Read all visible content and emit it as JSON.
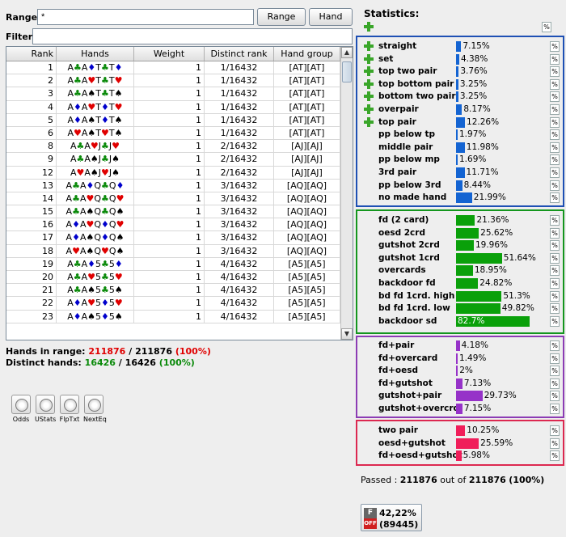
{
  "range": {
    "label": "Range:",
    "value": "*",
    "range_button": "Range",
    "hand_button": "Hand"
  },
  "filter": {
    "label": "Filter:",
    "value": ""
  },
  "table": {
    "columns": [
      "Rank",
      "Hands",
      "Weight",
      "Distinct rank",
      "Hand group"
    ],
    "rows": [
      {
        "rank": "1",
        "hand": [
          [
            "A",
            "c"
          ],
          [
            "A",
            "d"
          ],
          [
            "T",
            "c"
          ],
          [
            "T",
            "d"
          ]
        ],
        "weight": "1",
        "distinct": "1/16432",
        "group": "[AT][AT]"
      },
      {
        "rank": "2",
        "hand": [
          [
            "A",
            "c"
          ],
          [
            "A",
            "h"
          ],
          [
            "T",
            "c"
          ],
          [
            "T",
            "h"
          ]
        ],
        "weight": "1",
        "distinct": "1/16432",
        "group": "[AT][AT]"
      },
      {
        "rank": "3",
        "hand": [
          [
            "A",
            "c"
          ],
          [
            "A",
            "s"
          ],
          [
            "T",
            "c"
          ],
          [
            "T",
            "s"
          ]
        ],
        "weight": "1",
        "distinct": "1/16432",
        "group": "[AT][AT]"
      },
      {
        "rank": "4",
        "hand": [
          [
            "A",
            "d"
          ],
          [
            "A",
            "h"
          ],
          [
            "T",
            "d"
          ],
          [
            "T",
            "h"
          ]
        ],
        "weight": "1",
        "distinct": "1/16432",
        "group": "[AT][AT]"
      },
      {
        "rank": "5",
        "hand": [
          [
            "A",
            "d"
          ],
          [
            "A",
            "s"
          ],
          [
            "T",
            "d"
          ],
          [
            "T",
            "s"
          ]
        ],
        "weight": "1",
        "distinct": "1/16432",
        "group": "[AT][AT]"
      },
      {
        "rank": "6",
        "hand": [
          [
            "A",
            "h"
          ],
          [
            "A",
            "s"
          ],
          [
            "T",
            "h"
          ],
          [
            "T",
            "s"
          ]
        ],
        "weight": "1",
        "distinct": "1/16432",
        "group": "[AT][AT]"
      },
      {
        "rank": "8",
        "hand": [
          [
            "A",
            "c"
          ],
          [
            "A",
            "h"
          ],
          [
            "J",
            "c"
          ],
          [
            "J",
            "h"
          ]
        ],
        "weight": "1",
        "distinct": "2/16432",
        "group": "[AJ][AJ]"
      },
      {
        "rank": "9",
        "hand": [
          [
            "A",
            "c"
          ],
          [
            "A",
            "s"
          ],
          [
            "J",
            "c"
          ],
          [
            "J",
            "s"
          ]
        ],
        "weight": "1",
        "distinct": "2/16432",
        "group": "[AJ][AJ]"
      },
      {
        "rank": "12",
        "hand": [
          [
            "A",
            "h"
          ],
          [
            "A",
            "s"
          ],
          [
            "J",
            "h"
          ],
          [
            "J",
            "s"
          ]
        ],
        "weight": "1",
        "distinct": "2/16432",
        "group": "[AJ][AJ]"
      },
      {
        "rank": "13",
        "hand": [
          [
            "A",
            "c"
          ],
          [
            "A",
            "d"
          ],
          [
            "Q",
            "c"
          ],
          [
            "Q",
            "d"
          ]
        ],
        "weight": "1",
        "distinct": "3/16432",
        "group": "[AQ][AQ]"
      },
      {
        "rank": "14",
        "hand": [
          [
            "A",
            "c"
          ],
          [
            "A",
            "h"
          ],
          [
            "Q",
            "c"
          ],
          [
            "Q",
            "h"
          ]
        ],
        "weight": "1",
        "distinct": "3/16432",
        "group": "[AQ][AQ]"
      },
      {
        "rank": "15",
        "hand": [
          [
            "A",
            "c"
          ],
          [
            "A",
            "s"
          ],
          [
            "Q",
            "c"
          ],
          [
            "Q",
            "s"
          ]
        ],
        "weight": "1",
        "distinct": "3/16432",
        "group": "[AQ][AQ]"
      },
      {
        "rank": "16",
        "hand": [
          [
            "A",
            "d"
          ],
          [
            "A",
            "h"
          ],
          [
            "Q",
            "d"
          ],
          [
            "Q",
            "h"
          ]
        ],
        "weight": "1",
        "distinct": "3/16432",
        "group": "[AQ][AQ]"
      },
      {
        "rank": "17",
        "hand": [
          [
            "A",
            "d"
          ],
          [
            "A",
            "s"
          ],
          [
            "Q",
            "d"
          ],
          [
            "Q",
            "s"
          ]
        ],
        "weight": "1",
        "distinct": "3/16432",
        "group": "[AQ][AQ]"
      },
      {
        "rank": "18",
        "hand": [
          [
            "A",
            "h"
          ],
          [
            "A",
            "s"
          ],
          [
            "Q",
            "h"
          ],
          [
            "Q",
            "s"
          ]
        ],
        "weight": "1",
        "distinct": "3/16432",
        "group": "[AQ][AQ]"
      },
      {
        "rank": "19",
        "hand": [
          [
            "A",
            "c"
          ],
          [
            "A",
            "d"
          ],
          [
            "5",
            "c"
          ],
          [
            "5",
            "d"
          ]
        ],
        "weight": "1",
        "distinct": "4/16432",
        "group": "[A5][A5]"
      },
      {
        "rank": "20",
        "hand": [
          [
            "A",
            "c"
          ],
          [
            "A",
            "h"
          ],
          [
            "5",
            "c"
          ],
          [
            "5",
            "h"
          ]
        ],
        "weight": "1",
        "distinct": "4/16432",
        "group": "[A5][A5]"
      },
      {
        "rank": "21",
        "hand": [
          [
            "A",
            "c"
          ],
          [
            "A",
            "s"
          ],
          [
            "5",
            "c"
          ],
          [
            "5",
            "s"
          ]
        ],
        "weight": "1",
        "distinct": "4/16432",
        "group": "[A5][A5]"
      },
      {
        "rank": "22",
        "hand": [
          [
            "A",
            "d"
          ],
          [
            "A",
            "h"
          ],
          [
            "5",
            "d"
          ],
          [
            "5",
            "h"
          ]
        ],
        "weight": "1",
        "distinct": "4/16432",
        "group": "[A5][A5]"
      },
      {
        "rank": "23",
        "hand": [
          [
            "A",
            "d"
          ],
          [
            "A",
            "s"
          ],
          [
            "5",
            "d"
          ],
          [
            "5",
            "s"
          ]
        ],
        "weight": "1",
        "distinct": "4/16432",
        "group": "[A5][A5]"
      }
    ]
  },
  "suit_colors": {
    "c": "#0a8a0a",
    "d": "#0000cc",
    "h": "#e00000",
    "s": "#000000"
  },
  "summary": {
    "hands_label": "Hands in range:",
    "hands_value": "211876",
    "hands_sep": "/",
    "hands_total": "211876",
    "hands_pct": "(100%)",
    "distinct_label": "Distinct hands:",
    "distinct_value": "16426",
    "distinct_sep": "/",
    "distinct_total": "16426",
    "distinct_pct": "(100%)"
  },
  "tools": [
    "Odds",
    "UStats",
    "FlpTxt",
    "NextEq"
  ],
  "stats": {
    "title": "Statistics:",
    "pct_symbol": "%",
    "made": [
      {
        "name": "straight",
        "value": 7.15,
        "label": "7.15%",
        "expandable": true
      },
      {
        "name": "set",
        "value": 4.38,
        "label": "4.38%",
        "expandable": true
      },
      {
        "name": "top two pair",
        "value": 3.76,
        "label": "3.76%",
        "expandable": true
      },
      {
        "name": "top bottom pair",
        "value": 3.25,
        "label": "3.25%",
        "expandable": true
      },
      {
        "name": "bottom two pair",
        "value": 3.25,
        "label": "3.25%",
        "expandable": true
      },
      {
        "name": "overpair",
        "value": 8.17,
        "label": "8.17%",
        "expandable": true
      },
      {
        "name": "top pair",
        "value": 12.26,
        "label": "12.26%",
        "expandable": true
      },
      {
        "name": "pp below tp",
        "value": 1.97,
        "label": "1.97%",
        "expandable": false
      },
      {
        "name": "middle pair",
        "value": 11.98,
        "label": "11.98%",
        "expandable": false
      },
      {
        "name": "pp below mp",
        "value": 1.69,
        "label": "1.69%",
        "expandable": false
      },
      {
        "name": "3rd pair",
        "value": 11.71,
        "label": "11.71%",
        "expandable": false
      },
      {
        "name": "pp below 3rd",
        "value": 8.44,
        "label": "8.44%",
        "expandable": false
      },
      {
        "name": "no made hand",
        "value": 21.99,
        "label": "21.99%",
        "expandable": false
      }
    ],
    "draws": [
      {
        "name": "fd (2 card)",
        "value": 21.36,
        "label": "21.36%"
      },
      {
        "name": "oesd 2crd",
        "value": 25.62,
        "label": "25.62%"
      },
      {
        "name": "gutshot 2crd",
        "value": 19.96,
        "label": "19.96%"
      },
      {
        "name": "gutshot 1crd",
        "value": 51.64,
        "label": "51.64%"
      },
      {
        "name": "overcards",
        "value": 18.95,
        "label": "18.95%"
      },
      {
        "name": "backdoor fd",
        "value": 24.82,
        "label": "24.82%"
      },
      {
        "name": "bd fd 1crd. high",
        "value": 51.3,
        "label": "51.3%"
      },
      {
        "name": "bd fd 1crd. low",
        "value": 49.82,
        "label": "49.82%"
      },
      {
        "name": "backdoor sd",
        "value": 82.7,
        "label": "82.7%"
      }
    ],
    "combos": [
      {
        "name": "fd+pair",
        "value": 4.18,
        "label": "4.18%"
      },
      {
        "name": "fd+overcard",
        "value": 1.49,
        "label": "1.49%"
      },
      {
        "name": "fd+oesd",
        "value": 2,
        "label": "2%"
      },
      {
        "name": "fd+gutshot",
        "value": 7.13,
        "label": "7.13%"
      },
      {
        "name": "gutshot+pair",
        "value": 29.73,
        "label": "29.73%"
      },
      {
        "name": "gutshot+overcrd",
        "value": 7.15,
        "label": "7.15%"
      }
    ],
    "monsters": [
      {
        "name": "two pair",
        "value": 10.25,
        "label": "10.25%"
      },
      {
        "name": "oesd+gutshot",
        "value": 25.59,
        "label": "25.59%"
      },
      {
        "name": "fd+oesd+gutshot",
        "value": 5.98,
        "label": "5.98%"
      }
    ],
    "colors": {
      "made": "#1464d2",
      "draws": "#0aa00a",
      "combos": "#9632c8",
      "monsters": "#f01e5a",
      "made_border": "#1e50b4",
      "draws_border": "#14961e",
      "combos_border": "#8c3cb4",
      "monsters_border": "#dc2850"
    }
  },
  "passed": {
    "prefix": "Passed :",
    "count": "211876",
    "middle": "out of",
    "total": "211876",
    "pct": "(100%)"
  },
  "equity": {
    "badge_top": "F",
    "badge_bottom": "OFF",
    "value": "42,22%",
    "count": "(89445)"
  }
}
